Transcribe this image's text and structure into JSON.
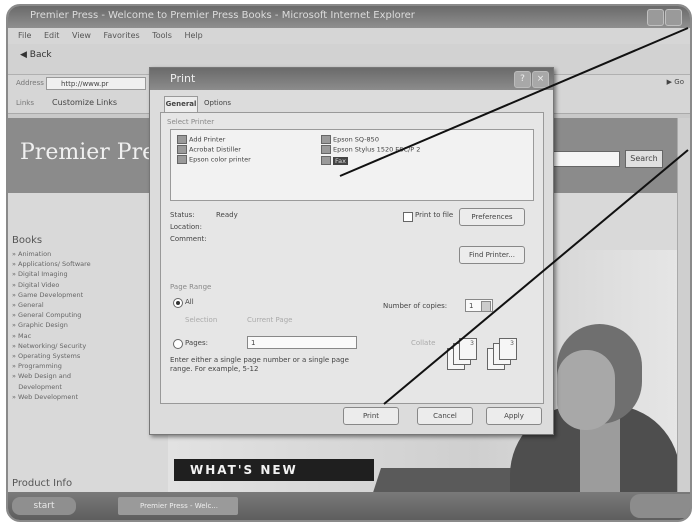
{
  "browser": {
    "title": "Premier Press - Welcome to Premier Press Books - Microsoft Internet Explorer",
    "menu": [
      "File",
      "Edit",
      "View",
      "Favorites",
      "Tools",
      "Help"
    ],
    "back_label": "Back",
    "address_label": "Address",
    "address_value": "http://www.pr",
    "go_label": "Go",
    "links_label": "Links",
    "links_item": "Customize Links"
  },
  "site": {
    "logo": "Premier Pres",
    "search_button": "Search",
    "sidebar_heading": "Books",
    "sidebar_items": [
      "Animation",
      "Applications/ Software",
      "Digital Imaging",
      "Digital Video",
      "Game Development",
      "General",
      "General Computing",
      "Graphic Design",
      "Mac",
      "Networking/ Security",
      "Operating Systems",
      "Programming",
      "Web Design and",
      "Development",
      "Web Development"
    ],
    "product_info": "Product Info",
    "banner": "WHAT'S NEW"
  },
  "taskbar": {
    "start": "start",
    "task": "Premier Press - Welc..."
  },
  "print_dialog": {
    "title": "Print",
    "tabs": [
      "General",
      "Options"
    ],
    "select_printer_label": "Select Printer",
    "printers": [
      {
        "name": "Add Printer",
        "selected": false
      },
      {
        "name": "Acrobat Distiller",
        "selected": false
      },
      {
        "name": "Epson color printer",
        "selected": false
      },
      {
        "name": "Epson SQ-850",
        "selected": false
      },
      {
        "name": "Epson Stylus 1520 ESC/P 2",
        "selected": false
      },
      {
        "name": "Fax",
        "selected": true
      }
    ],
    "status_label": "Status:",
    "status_value": "Ready",
    "location_label": "Location:",
    "comment_label": "Comment:",
    "print_to_file_label": "Print to file",
    "preferences_button": "Preferences",
    "find_printer_button": "Find Printer...",
    "page_range_label": "Page Range",
    "all_label": "All",
    "selection_label": "Selection",
    "current_page_label": "Current Page",
    "pages_label": "Pages:",
    "pages_value": "1",
    "page_help": "Enter either a single page number or a single page range.  For example, 5-12",
    "copies_label": "Number of copies:",
    "copies_value": "1",
    "collate_label": "Collate",
    "print_button": "Print",
    "cancel_button": "Cancel",
    "apply_button": "Apply"
  }
}
